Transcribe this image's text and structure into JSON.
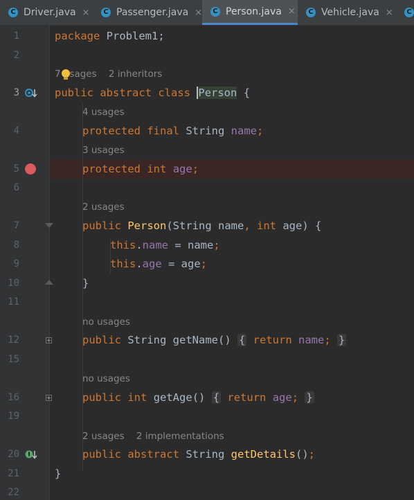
{
  "tabs": [
    {
      "label": "Driver.java",
      "icon": "class-icon",
      "icon_letter": "C",
      "close": "×"
    },
    {
      "label": "Passenger.java",
      "icon": "class-icon",
      "icon_letter": "C",
      "close": "×"
    },
    {
      "label": "Person.java",
      "icon": "class-icon",
      "icon_letter": "C",
      "close": "×",
      "active": true
    },
    {
      "label": "Vehicle.java",
      "icon": "class-icon",
      "icon_letter": "C",
      "close": "×"
    },
    {
      "label": "",
      "icon": "class-icon",
      "icon_letter": "C"
    }
  ],
  "line_numbers": [
    "1",
    "2",
    "3",
    "4",
    "5",
    "6",
    "7",
    "8",
    "9",
    "10",
    "11",
    "12",
    "15",
    "16",
    "19",
    "20",
    "21",
    "22"
  ],
  "hints": {
    "class_usages": "7 usages",
    "class_inheritors": "2 inheritors",
    "name_usages": "4 usages",
    "age_usages": "3 usages",
    "ctor_usages": "2 usages",
    "getname_usages": "no usages",
    "getage_usages": "no usages",
    "getdetails_usages": "2 usages",
    "getdetails_impls": "2 implementations"
  },
  "code": {
    "l1_kw": "package",
    "l1_rest": " Problem1;",
    "l3_kw1": "public",
    "l3_kw2": "abstract",
    "l3_kw3": "class",
    "l3_name": "Person",
    "l3_rest": " {",
    "l4_kw1": "protected",
    "l4_kw2": "final",
    "l4_type": " String ",
    "l4_field": "name",
    "l4_semi": ";",
    "l5_kw1": "protected",
    "l5_kw2": "int",
    "l5_field": "age",
    "l5_semi": ";",
    "l7_kw": "public",
    "l7_name": "Person",
    "l7_p1": "(String name",
    "l7_comma": ",",
    "l7_kw2": "int",
    "l7_p2": " age) {",
    "l8_this": "this",
    "l8_dot": ".",
    "l8_field": "name",
    "l8_rest": " = name",
    "l8_semi": ";",
    "l9_this": "this",
    "l9_dot": ".",
    "l9_field": "age",
    "l9_rest": " = age",
    "l9_semi": ";",
    "l10": "}",
    "l12_kw": "public",
    "l12_type": " String ",
    "l12_name": "getName",
    "l12_paren": "() ",
    "l12_ob": "{",
    "l12_ret": "return",
    "l12_field": "name",
    "l12_semi": ";",
    "l12_cb": "}",
    "l16_kw": "public",
    "l16_kw2": "int",
    "l16_name": "getAge",
    "l16_paren": "() ",
    "l16_ob": "{",
    "l16_ret": "return",
    "l16_field": "age",
    "l16_semi": ";",
    "l16_cb": "}",
    "l20_kw": "public",
    "l20_kw2": "abstract",
    "l20_type": " String ",
    "l20_name": "getDetails",
    "l20_rest": "()",
    "l20_semi": ";",
    "l21": "}"
  },
  "colors": {
    "keyword": "#cc7832",
    "field": "#9876aa",
    "method": "#ffc66d",
    "text": "#a9b7c6",
    "breakpoint": "#db5c5c",
    "tab_accent": "#4a88c7"
  }
}
